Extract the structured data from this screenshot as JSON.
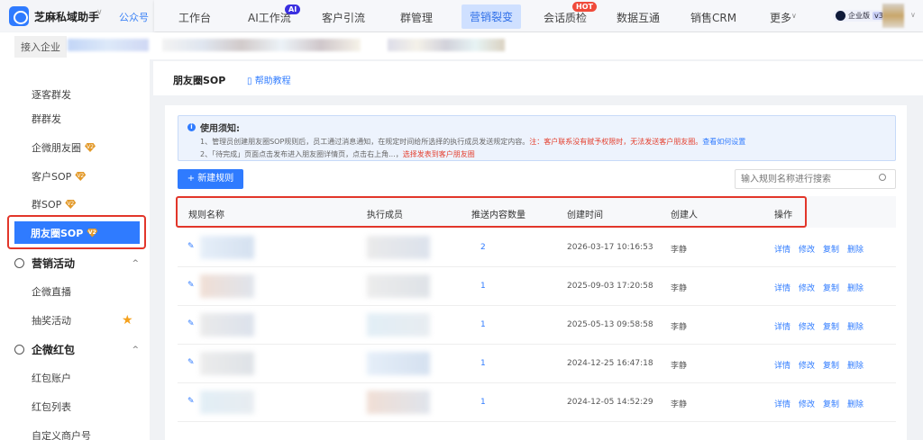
{
  "app": {
    "brand": "芝麻私域助手",
    "account": "公众号",
    "edition": "企业版",
    "version": "v3",
    "join": "接入企业"
  },
  "nav": [
    {
      "label": "工作台"
    },
    {
      "label": "AI工作流",
      "badge": "AI"
    },
    {
      "label": "客户引流"
    },
    {
      "label": "群管理"
    },
    {
      "label": "营销裂变",
      "active": true
    },
    {
      "label": "会话质检",
      "badge": "HOT"
    },
    {
      "label": "数据互通"
    },
    {
      "label": "销售CRM"
    },
    {
      "label": "更多"
    }
  ],
  "sidebar": {
    "items": [
      "逐客群发",
      "群群发",
      "企微朋友圈",
      "客户SOP",
      "群SOP",
      "朋友圈SOP"
    ],
    "groups": [
      {
        "label": "营销活动",
        "items": [
          "企微直播",
          "抽奖活动"
        ]
      },
      {
        "label": "企微红包",
        "items": [
          "红包账户",
          "红包列表",
          "自定义商户号"
        ]
      }
    ],
    "vip": "V2"
  },
  "page": {
    "title": "朋友圈SOP",
    "help": "帮助教程"
  },
  "notice": {
    "title": "使用须知:",
    "line1": "1、管理员创建朋友圈SOP规则后，员工通过消息通知，在规定时间给所选择的执行成员发送规定内容。",
    "line1_warn": "注：客户联系没有赋予权限时，无法发送客户朋友圈。",
    "line1_link": "查看如何设置",
    "line2": "2、「待完成」页面点击发布进入朋友圈详情页，点击右上角...，",
    "line2_warn": "选择发表到客户朋友圈"
  },
  "toolbar": {
    "new": "+ 新建规则",
    "search_placeholder": "输入规则名称进行搜索"
  },
  "table": {
    "headers": [
      "规则名称",
      "执行成员",
      "推送内容数量",
      "创建时间",
      "创建人",
      "操作"
    ],
    "actions": [
      "详情",
      "修改",
      "复制",
      "删除"
    ],
    "rows": [
      {
        "count": "2",
        "time": "2026-03-17 10:16:53",
        "creator": "李静"
      },
      {
        "count": "1",
        "time": "2025-09-03 17:20:58",
        "creator": "李静"
      },
      {
        "count": "1",
        "time": "2025-05-13 09:58:58",
        "creator": "李静"
      },
      {
        "count": "1",
        "time": "2024-12-25 16:47:18",
        "creator": "李静"
      },
      {
        "count": "1",
        "time": "2024-12-05 14:52:29",
        "creator": "李静"
      }
    ]
  },
  "colors": {
    "primary": "#2f7bff",
    "highlight": "#e2362a"
  }
}
